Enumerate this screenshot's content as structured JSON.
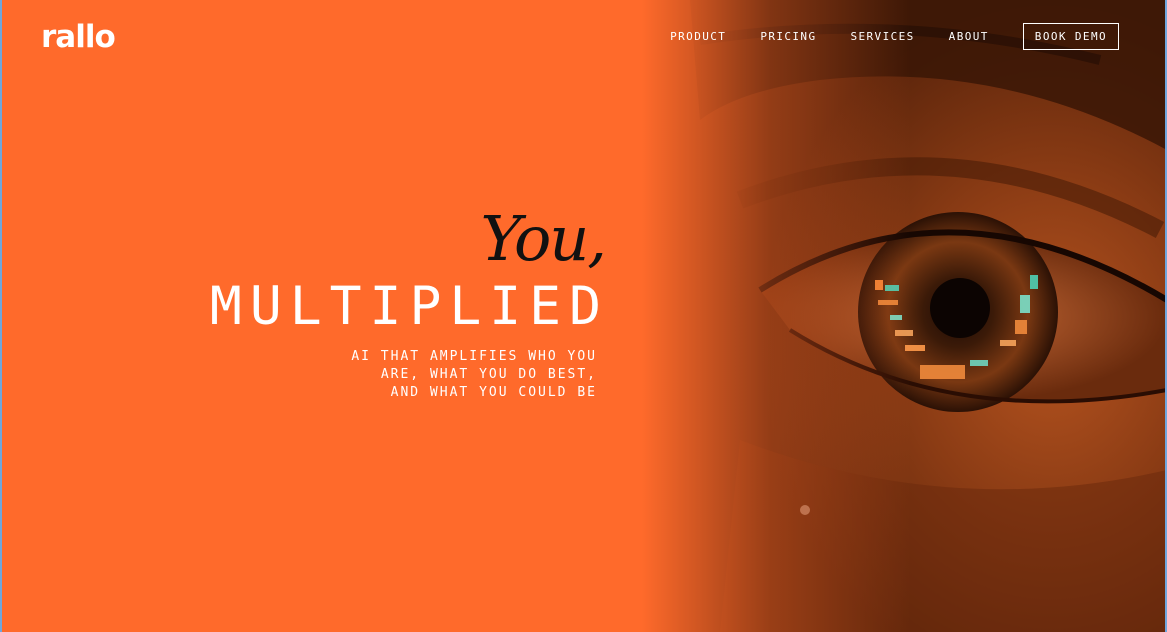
{
  "brand": {
    "logo_text": "rallo"
  },
  "nav": {
    "items": [
      {
        "label": "PRODUCT"
      },
      {
        "label": "PRICING"
      },
      {
        "label": "SERVICES"
      },
      {
        "label": "ABOUT"
      }
    ],
    "cta_label": "BOOK DEMO"
  },
  "hero": {
    "headline_italic": "You,",
    "headline_main": "MULTIPLIED",
    "tagline_lines": [
      "AI THAT AMPLIFIES WHO YOU",
      "ARE, WHAT YOU DO BEST,",
      "AND WHAT YOU COULD BE"
    ]
  },
  "colors": {
    "background": "#ff6a2b",
    "text_light": "#ffffff",
    "text_dark": "#111111"
  }
}
